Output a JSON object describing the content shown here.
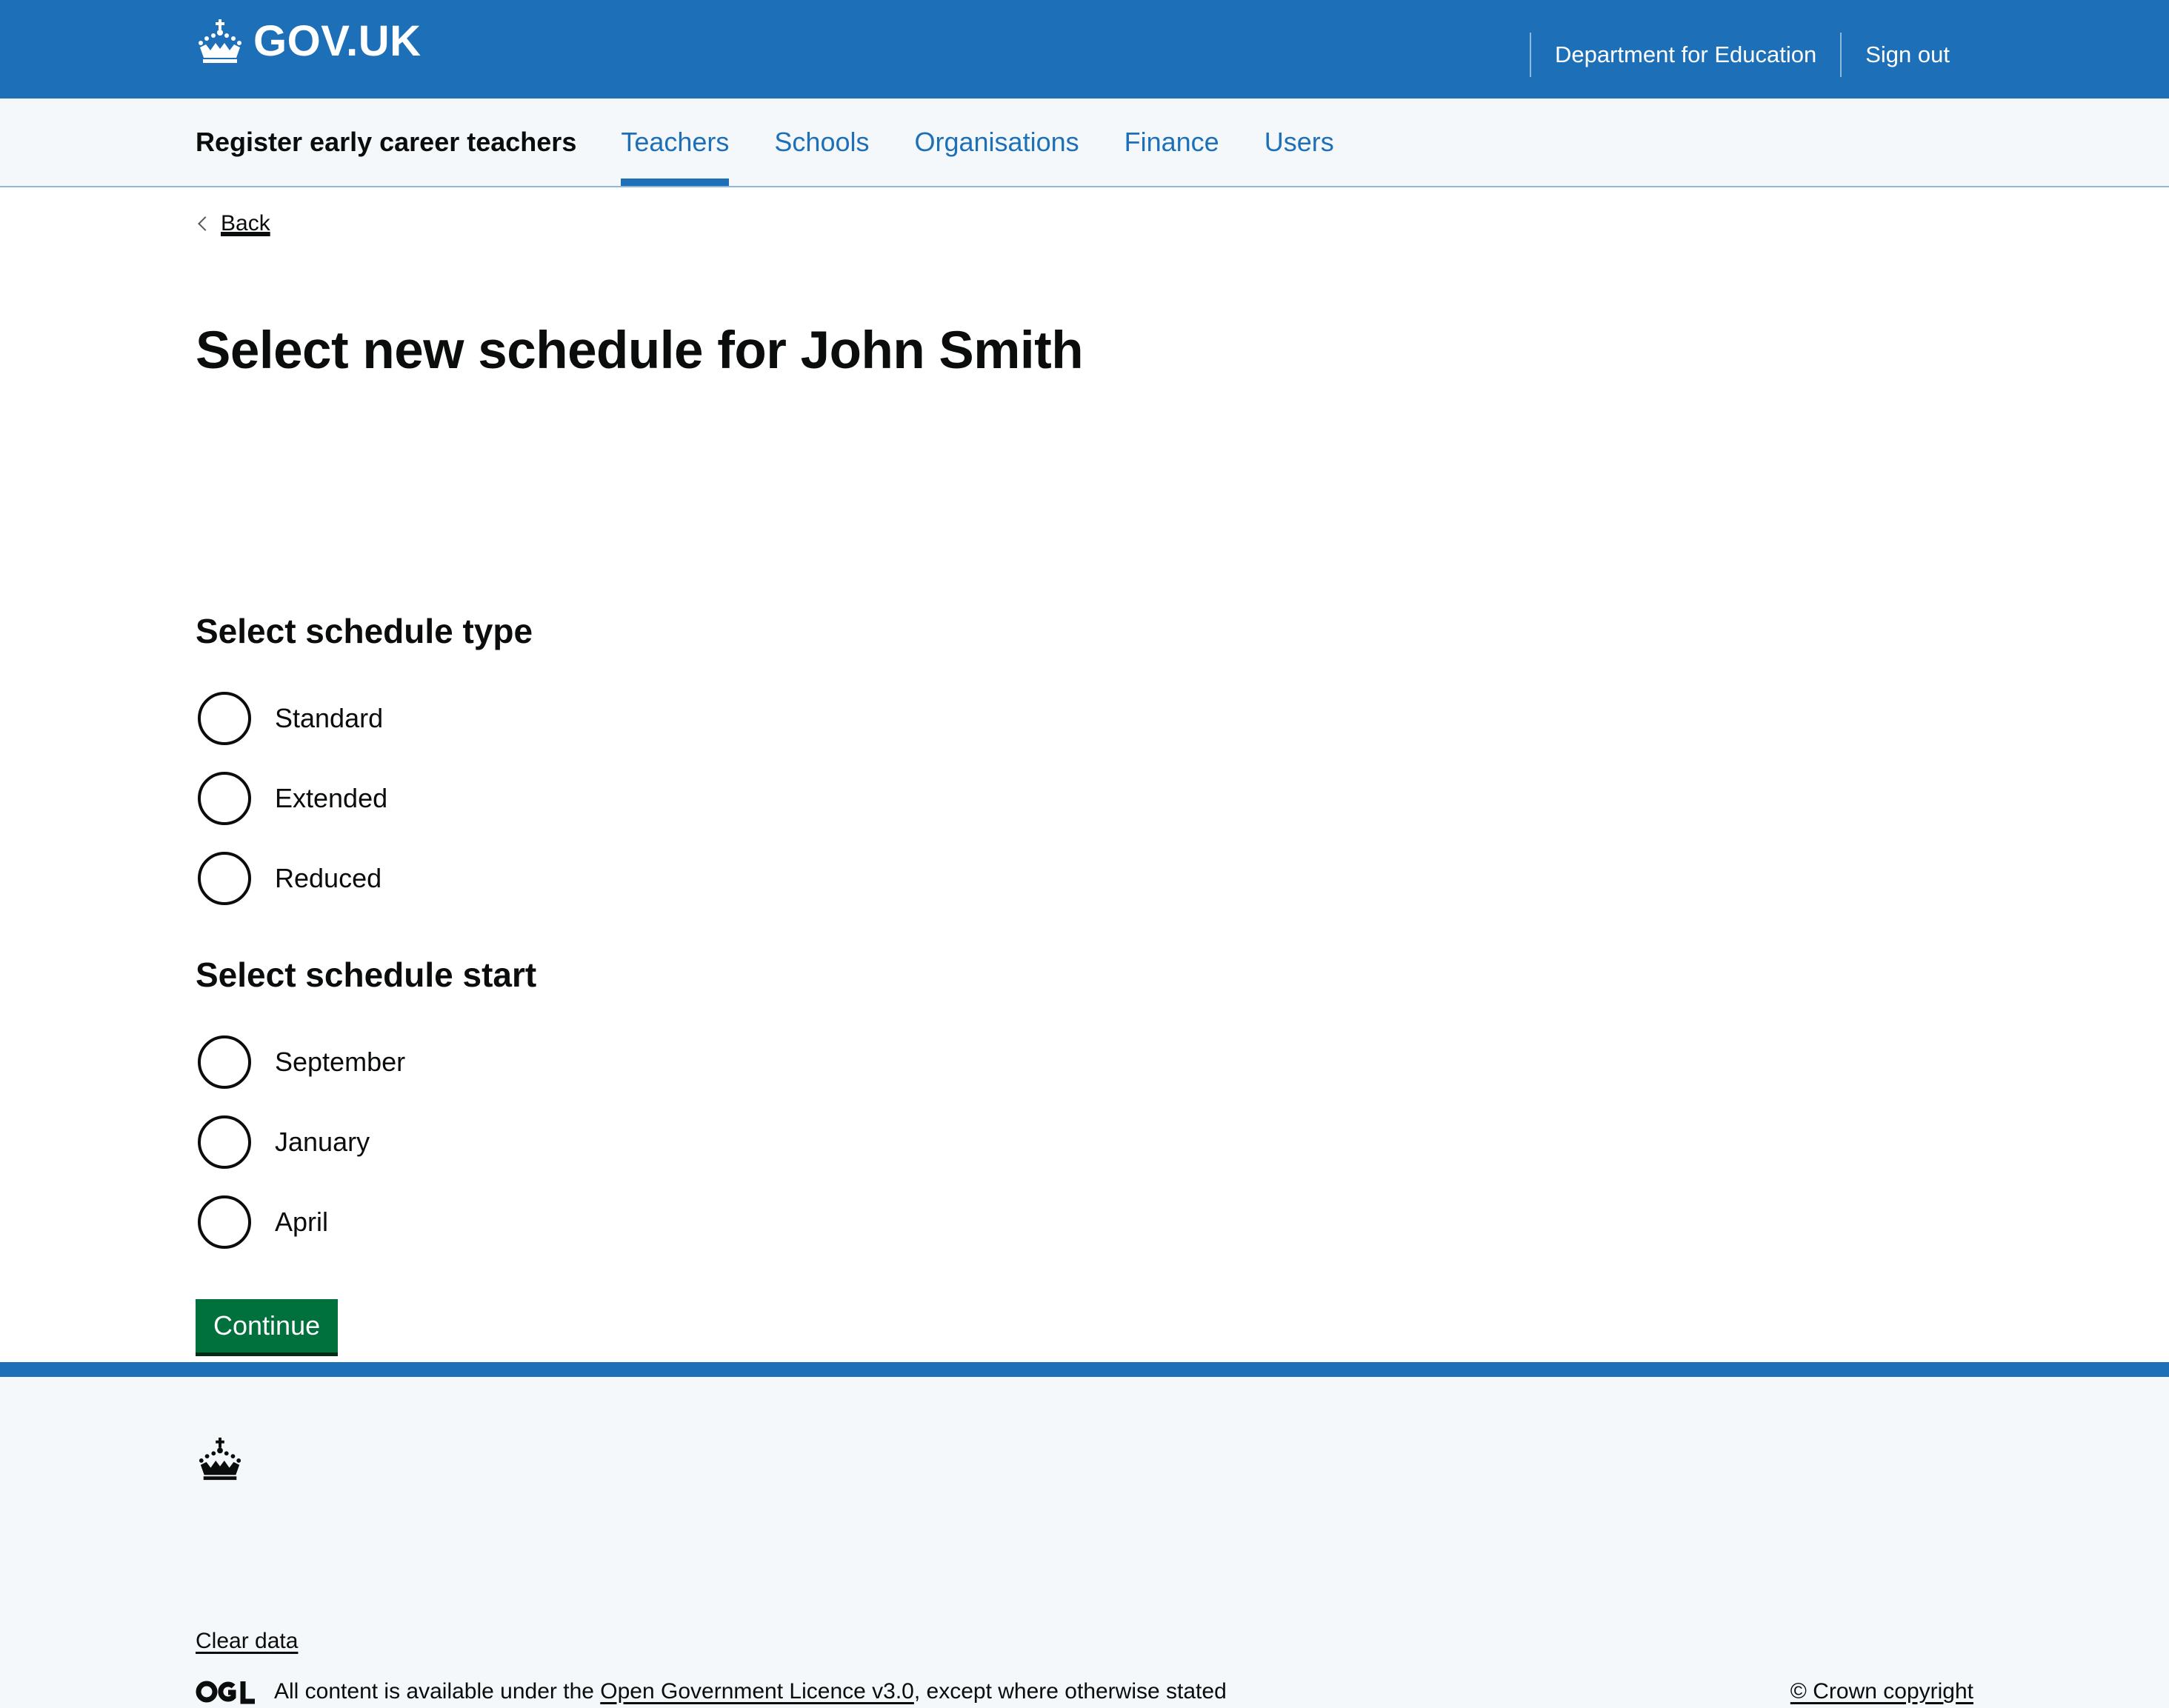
{
  "header": {
    "logo_text": "GOV.UK",
    "links": [
      "Department for Education",
      "Sign out"
    ]
  },
  "service_nav": {
    "service_name": "Register early career teachers",
    "items": [
      "Teachers",
      "Schools",
      "Organisations",
      "Finance",
      "Users"
    ],
    "active": "Teachers"
  },
  "main": {
    "back": "Back",
    "title": "Select new schedule for John Smith",
    "schedule_type": {
      "legend": "Select schedule type",
      "options": [
        "Standard",
        "Extended",
        "Reduced"
      ],
      "selected": null
    },
    "schedule_start": {
      "legend": "Select schedule start",
      "options": [
        "September",
        "January",
        "April"
      ],
      "selected": null
    },
    "continue": "Continue"
  },
  "footer": {
    "clear_data": "Clear data",
    "licence_prefix": "All content is available under the ",
    "licence_link": "Open Government Licence v3.0",
    "licence_suffix": ", except where otherwise stated",
    "copyright": "© Crown copyright"
  },
  "colors": {
    "brand_blue": "#1d70b8",
    "button_green": "#00703c",
    "footer_background": "#f4f8fb"
  },
  "icons": [
    "crown-icon",
    "chevron-left-icon",
    "ogl-logo"
  ]
}
